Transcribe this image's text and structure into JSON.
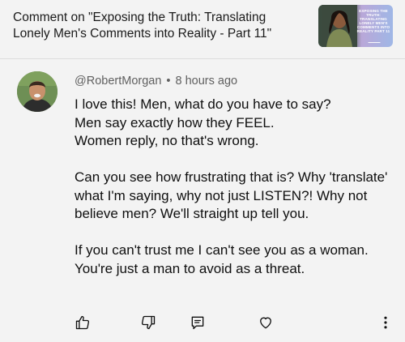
{
  "header": {
    "title": "Comment on \"Exposing the Truth: Translating Lonely Men's Comments into Reality - Part 11\"",
    "thumbnail_text": "EXPOSING THE TRUTH: TRANSLATING LONELY MEN'S COMMENTS INTO REALITY PART 11"
  },
  "comment": {
    "author": "@RobertMorgan",
    "separator": "•",
    "time": "8 hours ago",
    "paragraphs": [
      "I love this! Men, what do you have to say?\nMen say exactly how they FEEL.\nWomen reply, no that's wrong.",
      "Can you see how frustrating that is? Why 'translate' what I'm saying, why not just LISTEN?! Why not believe men? We'll straight up tell you.",
      "If you can't trust me I can't see you as a woman. You're just a man to avoid as a threat."
    ]
  },
  "actions": {
    "like": "like-icon",
    "dislike": "dislike-icon",
    "reply": "reply-icon",
    "heart": "heart-icon",
    "more": "more-vertical-icon"
  }
}
